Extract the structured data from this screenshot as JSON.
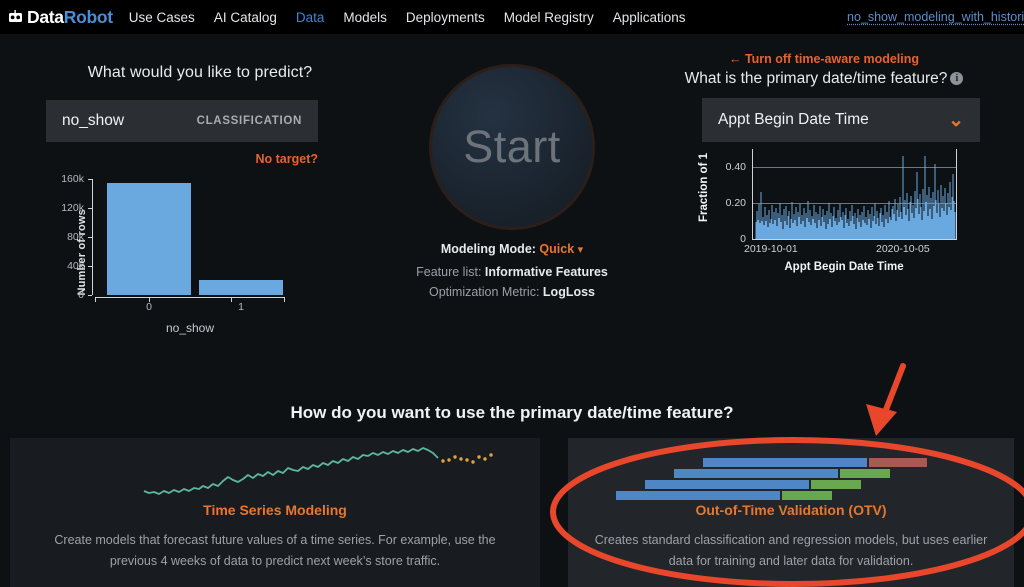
{
  "nav": {
    "logo_icon": "robot-head-icon",
    "logo_word1": "Data",
    "logo_word2": "Robot",
    "items": [
      {
        "label": "Use Cases",
        "active": false
      },
      {
        "label": "AI Catalog",
        "active": false
      },
      {
        "label": "Data",
        "active": true
      },
      {
        "label": "Models",
        "active": false
      },
      {
        "label": "Deployments",
        "active": false
      },
      {
        "label": "Model Registry",
        "active": false
      },
      {
        "label": "Applications",
        "active": false
      }
    ],
    "project_link": "no_show_modeling_with_histori"
  },
  "predict": {
    "title": "What would you like to predict?",
    "target_name": "no_show",
    "target_type": "CLASSIFICATION",
    "no_target_label": "No target?"
  },
  "start": {
    "button_label": "Start",
    "modeling_mode_key": "Modeling Mode:",
    "modeling_mode_value": "Quick",
    "modeling_mode_chevron": "chevron-down-icon",
    "feature_list_key": "Feature list:",
    "feature_list_value": "Informative Features",
    "optimization_metric_key": "Optimization Metric:",
    "optimization_metric_value": "LogLoss"
  },
  "datetime": {
    "turn_off_label": "← Turn off time-aware modeling",
    "title": "What is the primary date/time feature?",
    "info_icon": "info-icon",
    "selected_feature": "Appt Begin Date Time",
    "chevron": "chevron-down-icon"
  },
  "section": {
    "title": "How do you want to use the primary date/time feature?"
  },
  "cards": [
    {
      "id": "time-series-modeling",
      "title": "Time Series Modeling",
      "description": "Create models that forecast future values of a time series. For example, use the previous 4 weeks of data to predict next week’s store traffic.",
      "selected": false
    },
    {
      "id": "out-of-time-validation",
      "title": "Out-of-Time Validation (OTV)",
      "description": "Creates standard classification and regression models, but uses earlier data for training and later data for validation.",
      "selected": true
    }
  ],
  "annotations": {
    "arrow_color": "#e8472b",
    "ellipse_color": "#e8472b",
    "arrow_target": "out-of-time-validation"
  },
  "colors": {
    "accent_orange": "#e8772c",
    "accent_red_orange": "#e8622c",
    "link_blue": "#5b8fc9",
    "bar_blue": "#6aa9e0",
    "line_teal": "#5cb6a0",
    "forecast_orange": "#e2a33e",
    "otv_train": "#4f86c6",
    "otv_valid": "#6aa84f",
    "otv_holdout": "#a65a50",
    "page_bg": "#0d1114",
    "panel_bg": "#181c20",
    "panel_bg_selected": "#22262b",
    "input_bg": "#2b2f33"
  },
  "chart_data": [
    {
      "type": "bar",
      "name": "target-distribution",
      "title": "",
      "xlabel": "no_show",
      "ylabel": "Number of rows",
      "categories": [
        "0",
        "1"
      ],
      "values": [
        155000,
        20000
      ],
      "ylim": [
        0,
        160000
      ],
      "yticks": [
        "0",
        "40k",
        "80k",
        "120k",
        "160k"
      ],
      "ytick_values": [
        0,
        40000,
        80000,
        120000,
        160000
      ],
      "grid": false,
      "legend": "none",
      "series_color": "#6aa9e0"
    },
    {
      "type": "line",
      "name": "fraction-of-1-over-time",
      "title": "",
      "xlabel": "Appt Begin Date Time",
      "ylabel": "Fraction of 1",
      "xticks": [
        "2019-10-01",
        "2020-10-05"
      ],
      "yticks": [
        "0",
        "0.20",
        "0.40"
      ],
      "ytick_values": [
        0,
        0.2,
        0.4
      ],
      "ylim": [
        0,
        0.55
      ],
      "grid": true,
      "legend": "none",
      "series_color": "#6aa9e0",
      "description": "Dense daily spiky series averaging about 0.10 with occasional spikes to 0.35-0.52 near the end of the range"
    },
    {
      "type": "line",
      "name": "time-series-card-sparkline",
      "title": "Time Series Modeling",
      "xlabel": "",
      "ylabel": "",
      "grid": false,
      "legend": "none",
      "series": [
        {
          "name": "history",
          "color": "#5cb6a0",
          "values": [
            8,
            6,
            9,
            7,
            10,
            8,
            11,
            9,
            12,
            10,
            13,
            12,
            14,
            13,
            16,
            14,
            18,
            22,
            19,
            17,
            20,
            24,
            22,
            26,
            24,
            28,
            26,
            30,
            29,
            33,
            31,
            30,
            34,
            32,
            36,
            34,
            38,
            37,
            41,
            39,
            43,
            42,
            46,
            44,
            48,
            47,
            52,
            50,
            55,
            53,
            58,
            57,
            62,
            60,
            64,
            63,
            67,
            66,
            70,
            68,
            72,
            71,
            74,
            70
          ]
        },
        {
          "name": "forecast",
          "color": "#e2a33e",
          "values": [
            73,
            72,
            74,
            73,
            75,
            74,
            76,
            75,
            78,
            77
          ]
        }
      ]
    },
    {
      "type": "bar",
      "name": "otv-backtest-diagram",
      "title": "Out-of-Time Validation (OTV)",
      "grid": false,
      "legend": "none",
      "series": [
        {
          "name": "training",
          "color": "#4f86c6"
        },
        {
          "name": "validation",
          "color": "#6aa84f"
        },
        {
          "name": "holdout",
          "color": "#a65a50"
        }
      ],
      "rows": [
        {
          "train_start": 100,
          "train_width": 100,
          "valid_start": 0,
          "valid_width": 0,
          "holdout_start": 200,
          "holdout_width": 36
        },
        {
          "train_start": 70,
          "train_width": 100,
          "valid_start": 170,
          "valid_width": 30,
          "holdout_start": 0,
          "holdout_width": 0
        },
        {
          "train_start": 40,
          "train_width": 100,
          "valid_start": 140,
          "valid_width": 30,
          "holdout_start": 0,
          "holdout_width": 0
        },
        {
          "train_start": 10,
          "train_width": 100,
          "valid_start": 110,
          "valid_width": 30,
          "holdout_start": 0,
          "holdout_width": 0
        }
      ]
    }
  ]
}
